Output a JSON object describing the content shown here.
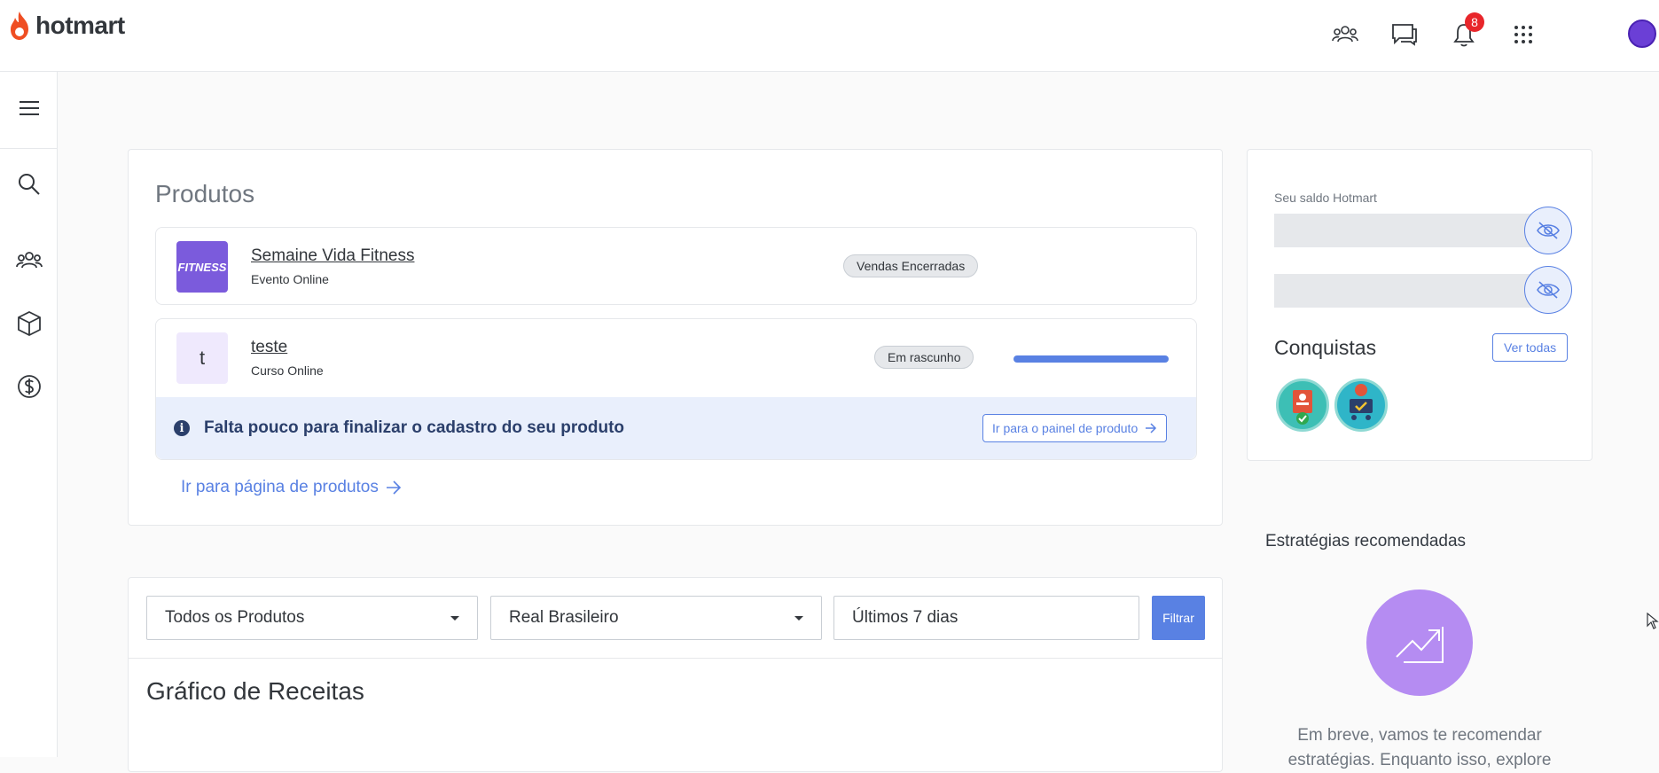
{
  "header": {
    "logo_text": "hotmart",
    "notifications_count": "8",
    "icons": [
      "people-icon",
      "chat-icon",
      "bell-icon",
      "apps-grid-icon"
    ]
  },
  "sidebar": {
    "items": [
      "menu-icon",
      "search-icon",
      "people-icon",
      "box-icon",
      "dollar-icon"
    ]
  },
  "products": {
    "title": "Produtos",
    "items": [
      {
        "name": "Semaine Vida Fitness",
        "type": "Evento Online",
        "status": "Vendas Encerradas",
        "thumb_text": "FITNESS"
      },
      {
        "name": "teste",
        "type": "Curso Online",
        "status": "Em rascunho",
        "thumb_text": "t"
      }
    ],
    "alert_text": "Falta pouco para finalizar o cadastro do seu produto",
    "alert_button": "Ir para o painel de produto",
    "link": "Ir para página de produtos"
  },
  "balance": {
    "label": "Seu saldo Hotmart",
    "achievements_title": "Conquistas",
    "see_all": "Ver todas"
  },
  "strategies": {
    "title": "Estratégias recomendadas",
    "text": "Em breve, vamos te recomendar estratégias. Enquanto isso, explore"
  },
  "filters": {
    "product": "Todos os Produtos",
    "currency": "Real Brasileiro",
    "period": "Últimos 7 dias",
    "button": "Filtrar"
  },
  "chart": {
    "title": "Gráfico de Receitas"
  },
  "colors": {
    "accent": "#5981e3",
    "brand": "#ef4e23",
    "badge": "#e8262b",
    "strategy_circle": "#b58cf2"
  }
}
